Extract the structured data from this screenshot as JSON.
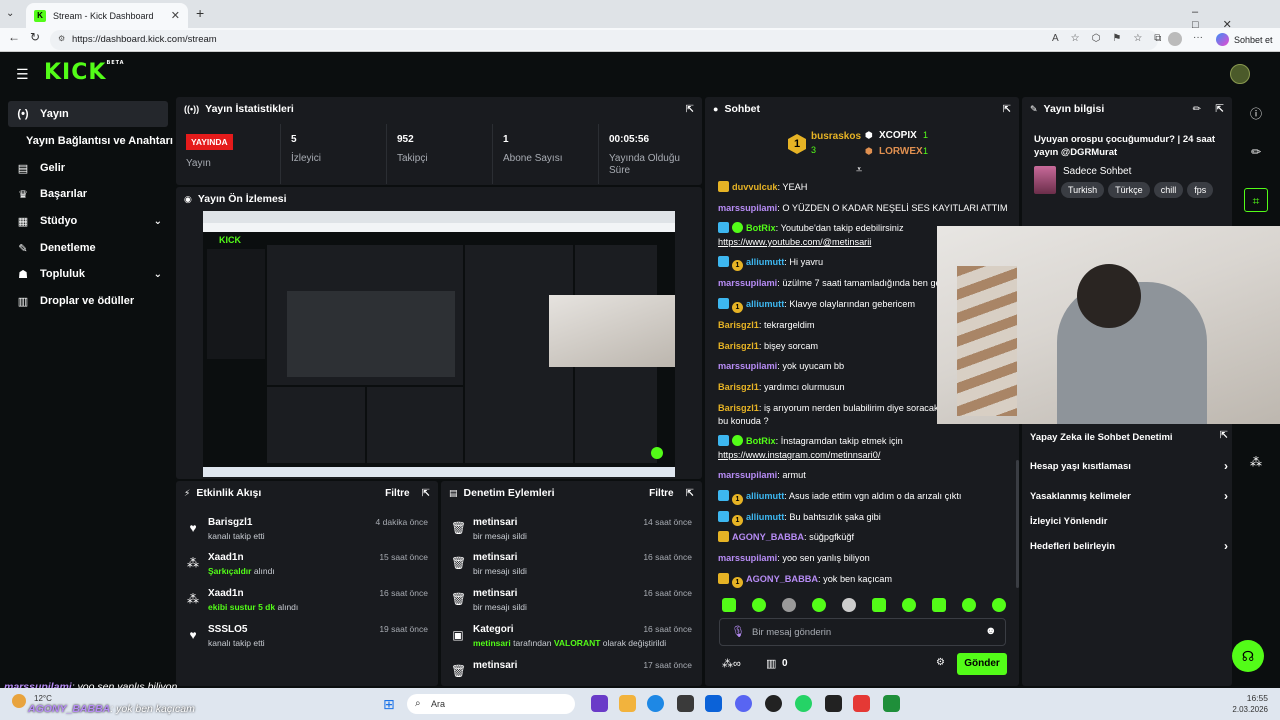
{
  "browser": {
    "tab_title": "Stream - Kick Dashboard",
    "url": "https://dashboard.kick.com/stream",
    "profile_button": "Sohbet et"
  },
  "app": {
    "logo": "KICK",
    "logo_badge": "BETA"
  },
  "sidebar": {
    "items": [
      {
        "label": "Yayın",
        "icon": "broadcast-icon"
      },
      {
        "label": "Yayın Bağlantısı ve Anahtarı",
        "icon": ""
      },
      {
        "label": "Gelir",
        "icon": "bank-icon"
      },
      {
        "label": "Başarılar",
        "icon": "trophy-icon"
      },
      {
        "label": "Stüdyo",
        "icon": "grid-icon"
      },
      {
        "label": "Denetleme",
        "icon": "wrench-icon"
      },
      {
        "label": "Topluluk",
        "icon": "users-icon"
      },
      {
        "label": "Droplar ve ödüller",
        "icon": "gift-icon"
      }
    ]
  },
  "stats": {
    "title": "Yayın İstatistikleri",
    "status_badge": "YAYINDA",
    "status_label": "Yayın",
    "viewers": {
      "value": "5",
      "label": "İzleyici"
    },
    "followers": {
      "value": "952",
      "label": "Takipçi"
    },
    "subs": {
      "value": "1",
      "label": "Abone Sayısı"
    },
    "duration": {
      "value": "00:05:56",
      "label": "Yayında Olduğu Süre"
    }
  },
  "preview": {
    "title": "Yayın Ön İzlemesi"
  },
  "activity": {
    "title": "Etkinlik Akışı",
    "filter": "Filtre",
    "events": [
      {
        "name": "Barisgzl1",
        "desc": "kanalı takip etti",
        "highlight": "",
        "suffix": "",
        "time": "4 dakika önce",
        "icon": "heart-icon"
      },
      {
        "name": "Xaad1n",
        "desc": "",
        "highlight": "Şarkıçaldır",
        "suffix": "alındı",
        "time": "15 saat önce",
        "icon": "kick-coin-icon"
      },
      {
        "name": "Xaad1n",
        "desc": "",
        "highlight": "ekibi sustur 5 dk",
        "suffix": "alındı",
        "time": "16 saat önce",
        "icon": "kick-coin-icon"
      },
      {
        "name": "SSSLO5",
        "desc": "kanalı takip etti",
        "highlight": "",
        "suffix": "",
        "time": "19 saat önce",
        "icon": "heart-icon"
      }
    ]
  },
  "moderation": {
    "title": "Denetim Eylemleri",
    "filter": "Filtre",
    "events": [
      {
        "name": "metinsari",
        "desc": "bir mesajı sildi",
        "time": "14 saat önce",
        "icon": "trash-icon"
      },
      {
        "name": "metinsari",
        "desc": "bir mesajı sildi",
        "time": "16 saat önce",
        "icon": "trash-icon"
      },
      {
        "name": "metinsari",
        "desc": "bir mesajı sildi",
        "time": "16 saat önce",
        "icon": "trash-icon"
      },
      {
        "name": "Kategori",
        "desc_pre": "metinsari",
        "desc_mid": "tarafından",
        "desc_hl": "VALORANT",
        "desc_post": "olarak değiştirildi",
        "time": "16 saat önce",
        "icon": "category-icon"
      },
      {
        "name": "metinsari",
        "desc": "bir mesajı sildi",
        "time": "17 saat önce",
        "icon": "trash-icon"
      }
    ]
  },
  "chat": {
    "title": "Sohbet",
    "leaders": {
      "first": {
        "rank": "1",
        "name": "busraskos",
        "count": "3"
      },
      "second": {
        "name": "XCOPIX",
        "count": "1"
      },
      "third": {
        "name": "LORWEX",
        "count": "1"
      }
    },
    "messages": [
      {
        "user": "duvvulcuk",
        "text": "YEAH"
      },
      {
        "user": "marssupilami",
        "text": "O YÜZDEN O KADAR NEŞELİ SES KAYITLARI ATTIM"
      },
      {
        "user": "BotRix",
        "text": "Youtube'dan takip edebilirsiniz",
        "link": "https://www.youtube.com/@metinsarii"
      },
      {
        "user": "alliumutt",
        "text": "Hi yavru"
      },
      {
        "user": "marssupilami",
        "text": "üzülme 7 saati tamamladığında ben ge"
      },
      {
        "user": "alliumutt",
        "text": "Klavye olaylarından gebericem"
      },
      {
        "user": "Barisgzl1",
        "text": "tekrargeldim"
      },
      {
        "user": "Barisgzl1",
        "text": "bişey sorcam"
      },
      {
        "user": "marssupilami",
        "text": "yok uyucam bb"
      },
      {
        "user": "Barisgzl1",
        "text": "yardımcı olurmusun"
      },
      {
        "user": "Barisgzl1",
        "text": "iş arıyorum nerden bulabilirim diye soracakt",
        "cont": "bu konuda ?"
      },
      {
        "user": "BotRix",
        "text": "İnstagramdan takip etmek için",
        "link": "https://www.instagram.com/metinnsari0/"
      },
      {
        "user": "marssupilami",
        "text": "armut"
      },
      {
        "user": "alliumutt",
        "text": "Asus iade ettim vgn aldım o da arızalı çıktı"
      },
      {
        "user": "alliumutt",
        "text": "Bu bahtsızlık şaka gibi"
      },
      {
        "user": "AGONY_BABBA",
        "text": "süğpgfküğf"
      },
      {
        "user": "marssupilami",
        "text": "yoo sen yanlış biliyon"
      },
      {
        "user": "AGONY_BABBA",
        "text": "yok ben kaçıcam"
      }
    ],
    "input_placeholder": "Bir mesaj gönderin",
    "send_button": "Gönder",
    "points": "0"
  },
  "stream_info": {
    "title": "Yayın bilgisi",
    "stream_title": "Uyuyan orospu çocuğumudur? | 24 saat yayın @DGRMurat",
    "category": "Sadece Sohbet",
    "tags": [
      "Turkish",
      "Türkçe",
      "chill",
      "fps"
    ]
  },
  "mod_links": [
    {
      "label": "Yapay Zeka ile Sohbet Denetimi"
    },
    {
      "label": "Hesap yaşı kısıtlaması"
    },
    {
      "label": "Yasaklanmış kelimeler"
    },
    {
      "label": "İzleyici Yönlendir"
    },
    {
      "label": "Hedefleri belirleyin"
    }
  ],
  "overlay": {
    "line1_user": "marssupilami",
    "line1_text": ": yoo sen yanlış biliyon",
    "line2_user": "AGONY_BABBA",
    "line2_text": ": yok ben kaçıcam"
  },
  "taskbar": {
    "weather": "12°C",
    "search": "Ara",
    "time": "16:55",
    "date": "2.03.2026"
  },
  "colors": {
    "accent": "#53fc18",
    "live": "#e51b1b",
    "panel": "#191b1f"
  }
}
